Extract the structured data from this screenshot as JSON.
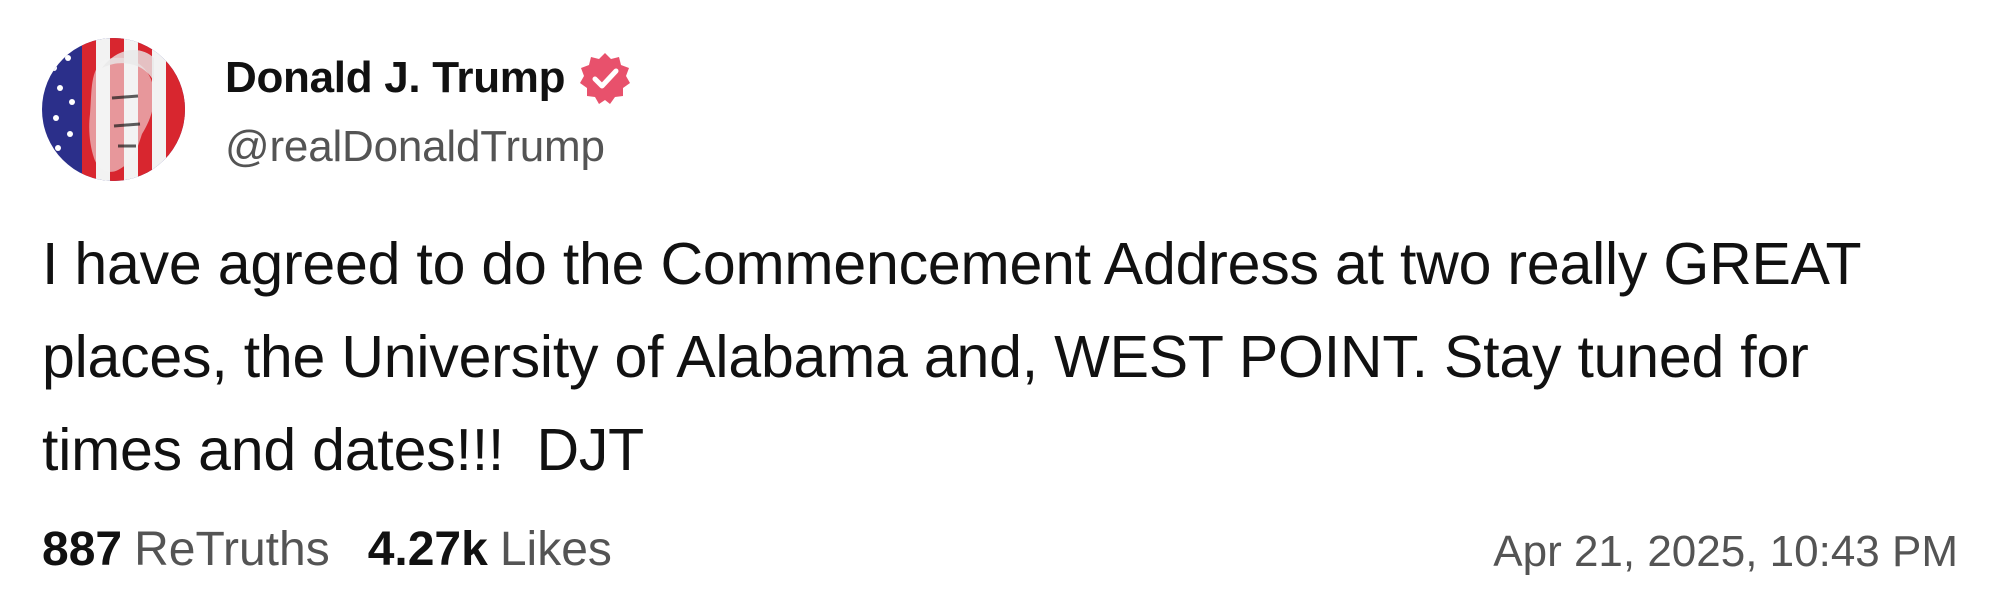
{
  "author": {
    "display_name": "Donald J. Trump",
    "handle": "@realDonaldTrump",
    "verified": true,
    "verified_color": "#e8516c",
    "avatar_icon": "american-flag-portrait"
  },
  "post": {
    "text": "I have agreed to do the Commencement Address at two really GREAT places, the University of Alabama and, WEST POINT. Stay tuned for times and dates!!!  DJT"
  },
  "stats": {
    "retruths_count": "887",
    "retruths_label": "ReTruths",
    "likes_count": "4.27k",
    "likes_label": "Likes"
  },
  "timestamp": "Apr 21, 2025, 10:43 PM"
}
